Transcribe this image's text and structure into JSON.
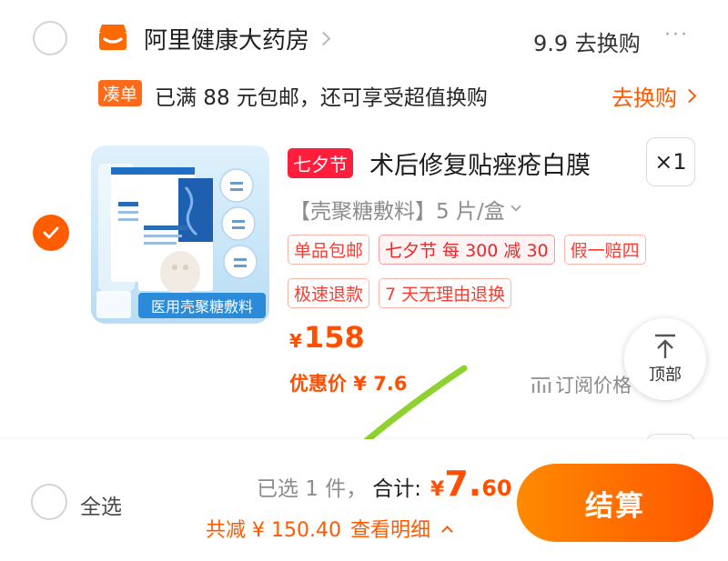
{
  "colors": {
    "accent": "#ff5a00",
    "festival_red": "#ff1f3d",
    "checkout_gradient_start": "#ff8a00",
    "checkout_gradient_end": "#ff5500"
  },
  "shop": {
    "name": "阿里健康大药房",
    "swap_link": "9.9 去换购",
    "more": "···"
  },
  "promo": {
    "tag": "凑单",
    "text": "已满 88 元包邮，还可享受超值换购",
    "link": "去换购"
  },
  "product": {
    "checked": true,
    "image_caption": "医用壳聚糖敷料",
    "festival_tag": "七夕节",
    "title": "术后修复贴痤疮白膜",
    "quantity": "×1",
    "sku": "【壳聚糖敷料】5 片/盒",
    "badges_row1": [
      "单品包邮",
      "七夕节  每 300 减 30",
      "假一赔四"
    ],
    "badges_row2": [
      "极速退款",
      "7 天无理由退换"
    ],
    "price_symbol": "¥",
    "price": "158",
    "discount_price": "优惠价 ¥ 7.6",
    "subscribe": "订阅价格"
  },
  "back_to_top": {
    "label": "顶部"
  },
  "footer": {
    "select_all": "全选",
    "selected": "已选 1 件，",
    "total_label": "合计:",
    "total_symbol": "¥",
    "total_int": "7.",
    "total_dec": "60",
    "reduce": "共减 ¥ 150.40",
    "details": "查看明细",
    "checkout": "结算"
  }
}
